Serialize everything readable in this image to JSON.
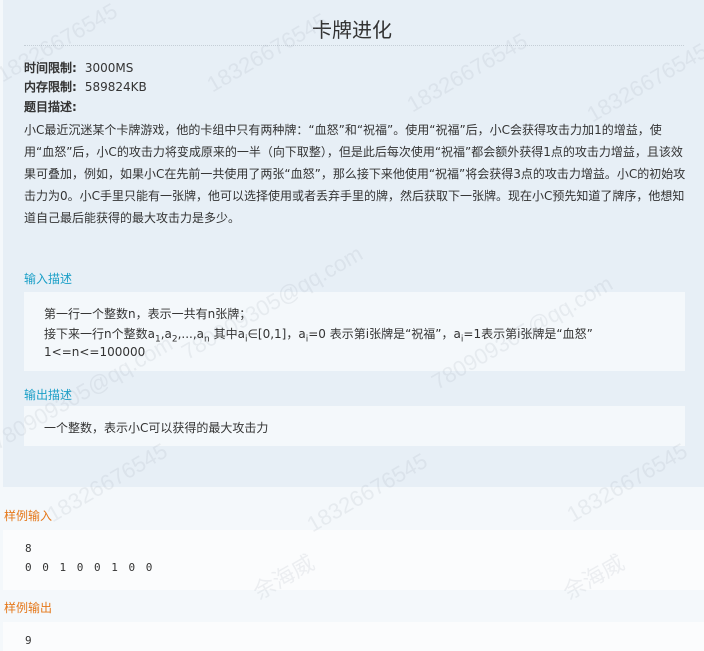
{
  "problem": {
    "title": "卡牌进化",
    "time_limit_label": "时间限制:",
    "time_limit_value": "3000MS",
    "memory_limit_label": "内存限制:",
    "memory_limit_value": "589824KB",
    "description_label": "题目描述:",
    "description": "小C最近沉迷某个卡牌游戏，他的卡组中只有两种牌：“血怒”和“祝福”。使用“祝福”后，小C会获得攻击力加1的增益，使用“血怒”后，小C的攻击力将变成原来的一半（向下取整），但是此后每次使用“祝福”都会额外获得1点的攻击力增益，且该效果可叠加，例如，如果小C在先前一共使用了两张“血怒”，那么接下来他使用“祝福”将会获得3点的攻击力增益。小C的初始攻击力为0。小C手里只能有一张牌，他可以选择使用或者丢弃手里的牌，然后获取下一张牌。现在小C预先知道了牌序，他想知道自己最后能获得的最大攻击力是多少。"
  },
  "input_section": {
    "heading": "输入描述",
    "line1": "第一行一个整数n，表示一共有n张牌；",
    "line2": {
      "prefix": "接下来一行n个整数a",
      "sub1": "1",
      "mid1": ",a",
      "sub2": "2",
      "mid2": ",...,a",
      "sub3": "n",
      "mid3": " 其中a",
      "sub4": "i",
      "mid4": "∈[0,1]，a",
      "sub5": "i",
      "mid5": "=0 表示第i张牌是“祝福”，a",
      "sub6": "i",
      "suffix": "=1表示第i张牌是“血怒”"
    },
    "line3": "1<=n<=100000"
  },
  "output_section": {
    "heading": "输出描述",
    "line1": "一个整数，表示小C可以获得的最大攻击力"
  },
  "sample_input": {
    "heading": "样例输入",
    "line1": "8",
    "line2": "0 0 1 0 0 1 0 0"
  },
  "sample_output": {
    "heading": "样例输出",
    "line1": "9"
  },
  "watermark": {
    "text1": "18326676545",
    "text2": "余海威",
    "text3": "780909305@qq.com"
  }
}
